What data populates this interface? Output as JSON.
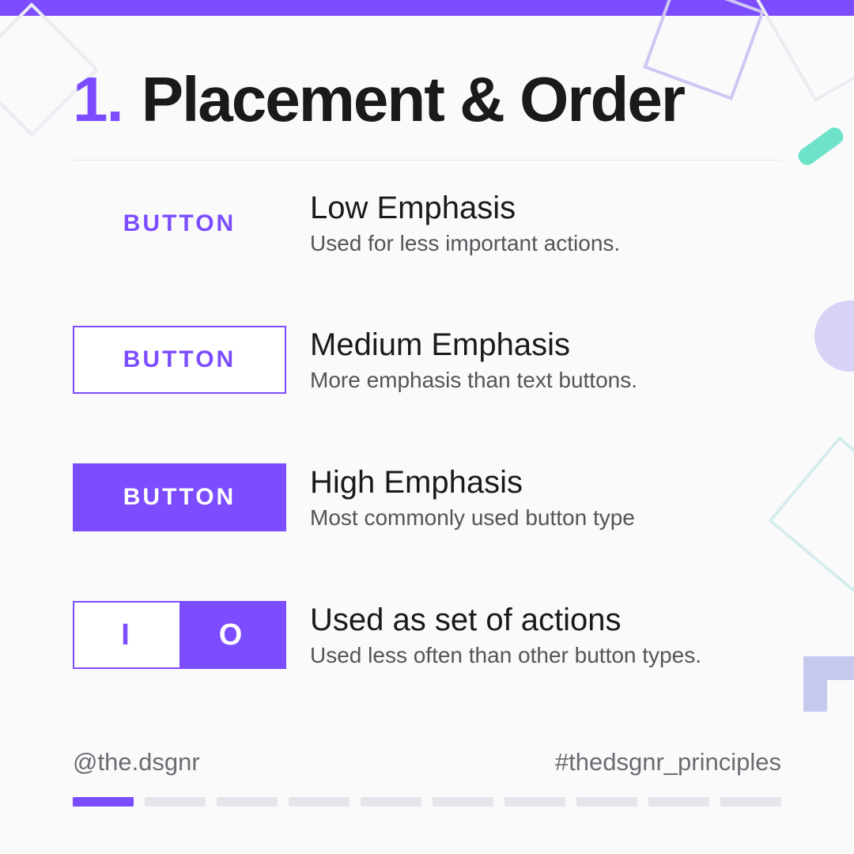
{
  "colors": {
    "accent": "#7c4dff"
  },
  "header": {
    "number": "1.",
    "title": "Placement & Order"
  },
  "rows": [
    {
      "button_label": "BUTTON",
      "title": "Low Emphasis",
      "subtitle": "Used for less important actions."
    },
    {
      "button_label": "BUTTON",
      "title": "Medium Emphasis",
      "subtitle": "More emphasis than text buttons."
    },
    {
      "button_label": "BUTTON",
      "title": "High Emphasis",
      "subtitle": "Most commonly used button type"
    },
    {
      "toggle_left": "I",
      "toggle_right": "O",
      "title": "Used as set of actions",
      "subtitle": "Used less often than other button types."
    }
  ],
  "footer": {
    "handle": "@the.dsgnr",
    "hashtag": "#thedsgnr_principles",
    "pager_total": 10,
    "pager_active_index": 0
  }
}
